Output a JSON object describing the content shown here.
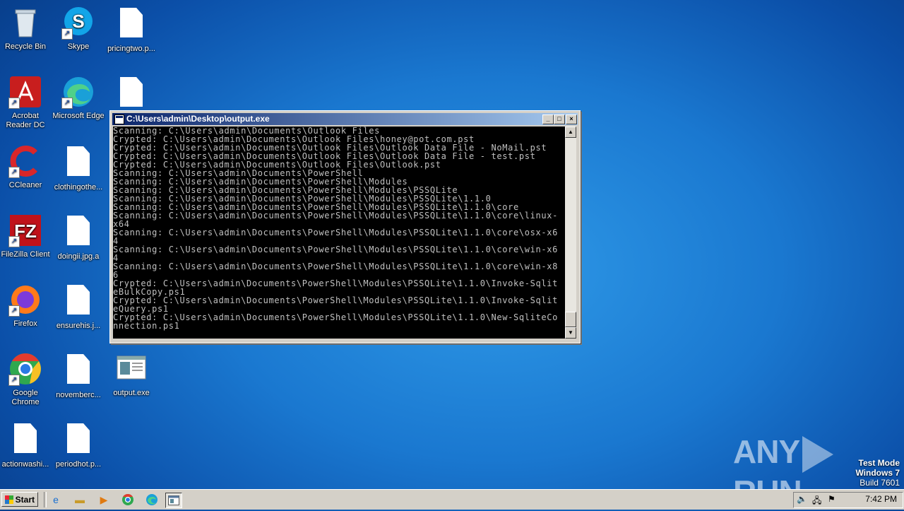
{
  "desktop": {
    "icons": [
      {
        "label": "Recycle Bin"
      },
      {
        "label": "Skype"
      },
      {
        "label": "pricingtwo.p..."
      },
      {
        "label": "Acrobat Reader DC"
      },
      {
        "label": "Microsoft Edge"
      },
      {
        "label": "CCleaner"
      },
      {
        "label": "clothingothe..."
      },
      {
        "label": "FileZilla Client"
      },
      {
        "label": "doingii.jpg.a"
      },
      {
        "label": "Firefox"
      },
      {
        "label": "ensurehis.j..."
      },
      {
        "label": "Google Chrome"
      },
      {
        "label": "novemberc..."
      },
      {
        "label": "output.exe"
      },
      {
        "label": "actionwashi..."
      },
      {
        "label": "periodhot.p..."
      }
    ]
  },
  "console": {
    "title": "C:\\Users\\admin\\Desktop\\output.exe",
    "lines": [
      "Scanning: C:\\Users\\admin\\Documents\\Outlook Files",
      "Crypted: C:\\Users\\admin\\Documents\\Outlook Files\\honey@pot.com.pst",
      "Crypted: C:\\Users\\admin\\Documents\\Outlook Files\\Outlook Data File - NoMail.pst",
      "Crypted: C:\\Users\\admin\\Documents\\Outlook Files\\Outlook Data File - test.pst",
      "Crypted: C:\\Users\\admin\\Documents\\Outlook Files\\Outlook.pst",
      "Scanning: C:\\Users\\admin\\Documents\\PowerShell",
      "Scanning: C:\\Users\\admin\\Documents\\PowerShell\\Modules",
      "Scanning: C:\\Users\\admin\\Documents\\PowerShell\\Modules\\PSSQLite",
      "Scanning: C:\\Users\\admin\\Documents\\PowerShell\\Modules\\PSSQLite\\1.1.0",
      "Scanning: C:\\Users\\admin\\Documents\\PowerShell\\Modules\\PSSQLite\\1.1.0\\core",
      "Scanning: C:\\Users\\admin\\Documents\\PowerShell\\Modules\\PSSQLite\\1.1.0\\core\\linux-",
      "x64",
      "Scanning: C:\\Users\\admin\\Documents\\PowerShell\\Modules\\PSSQLite\\1.1.0\\core\\osx-x6",
      "4",
      "Scanning: C:\\Users\\admin\\Documents\\PowerShell\\Modules\\PSSQLite\\1.1.0\\core\\win-x6",
      "4",
      "Scanning: C:\\Users\\admin\\Documents\\PowerShell\\Modules\\PSSQLite\\1.1.0\\core\\win-x8",
      "6",
      "Crypted: C:\\Users\\admin\\Documents\\PowerShell\\Modules\\PSSQLite\\1.1.0\\Invoke-Sqlit",
      "eBulkCopy.ps1",
      "Crypted: C:\\Users\\admin\\Documents\\PowerShell\\Modules\\PSSQLite\\1.1.0\\Invoke-Sqlit",
      "eQuery.ps1",
      "Crypted: C:\\Users\\admin\\Documents\\PowerShell\\Modules\\PSSQLite\\1.1.0\\New-SqliteCo",
      "nnection.ps1"
    ]
  },
  "watermark": {
    "brand_left": "ANY",
    "brand_right": "RUN",
    "test_mode": "Test Mode",
    "os": "Windows 7",
    "build": "Build 7601"
  },
  "taskbar": {
    "start_label": "Start",
    "clock": "7:42 PM"
  }
}
